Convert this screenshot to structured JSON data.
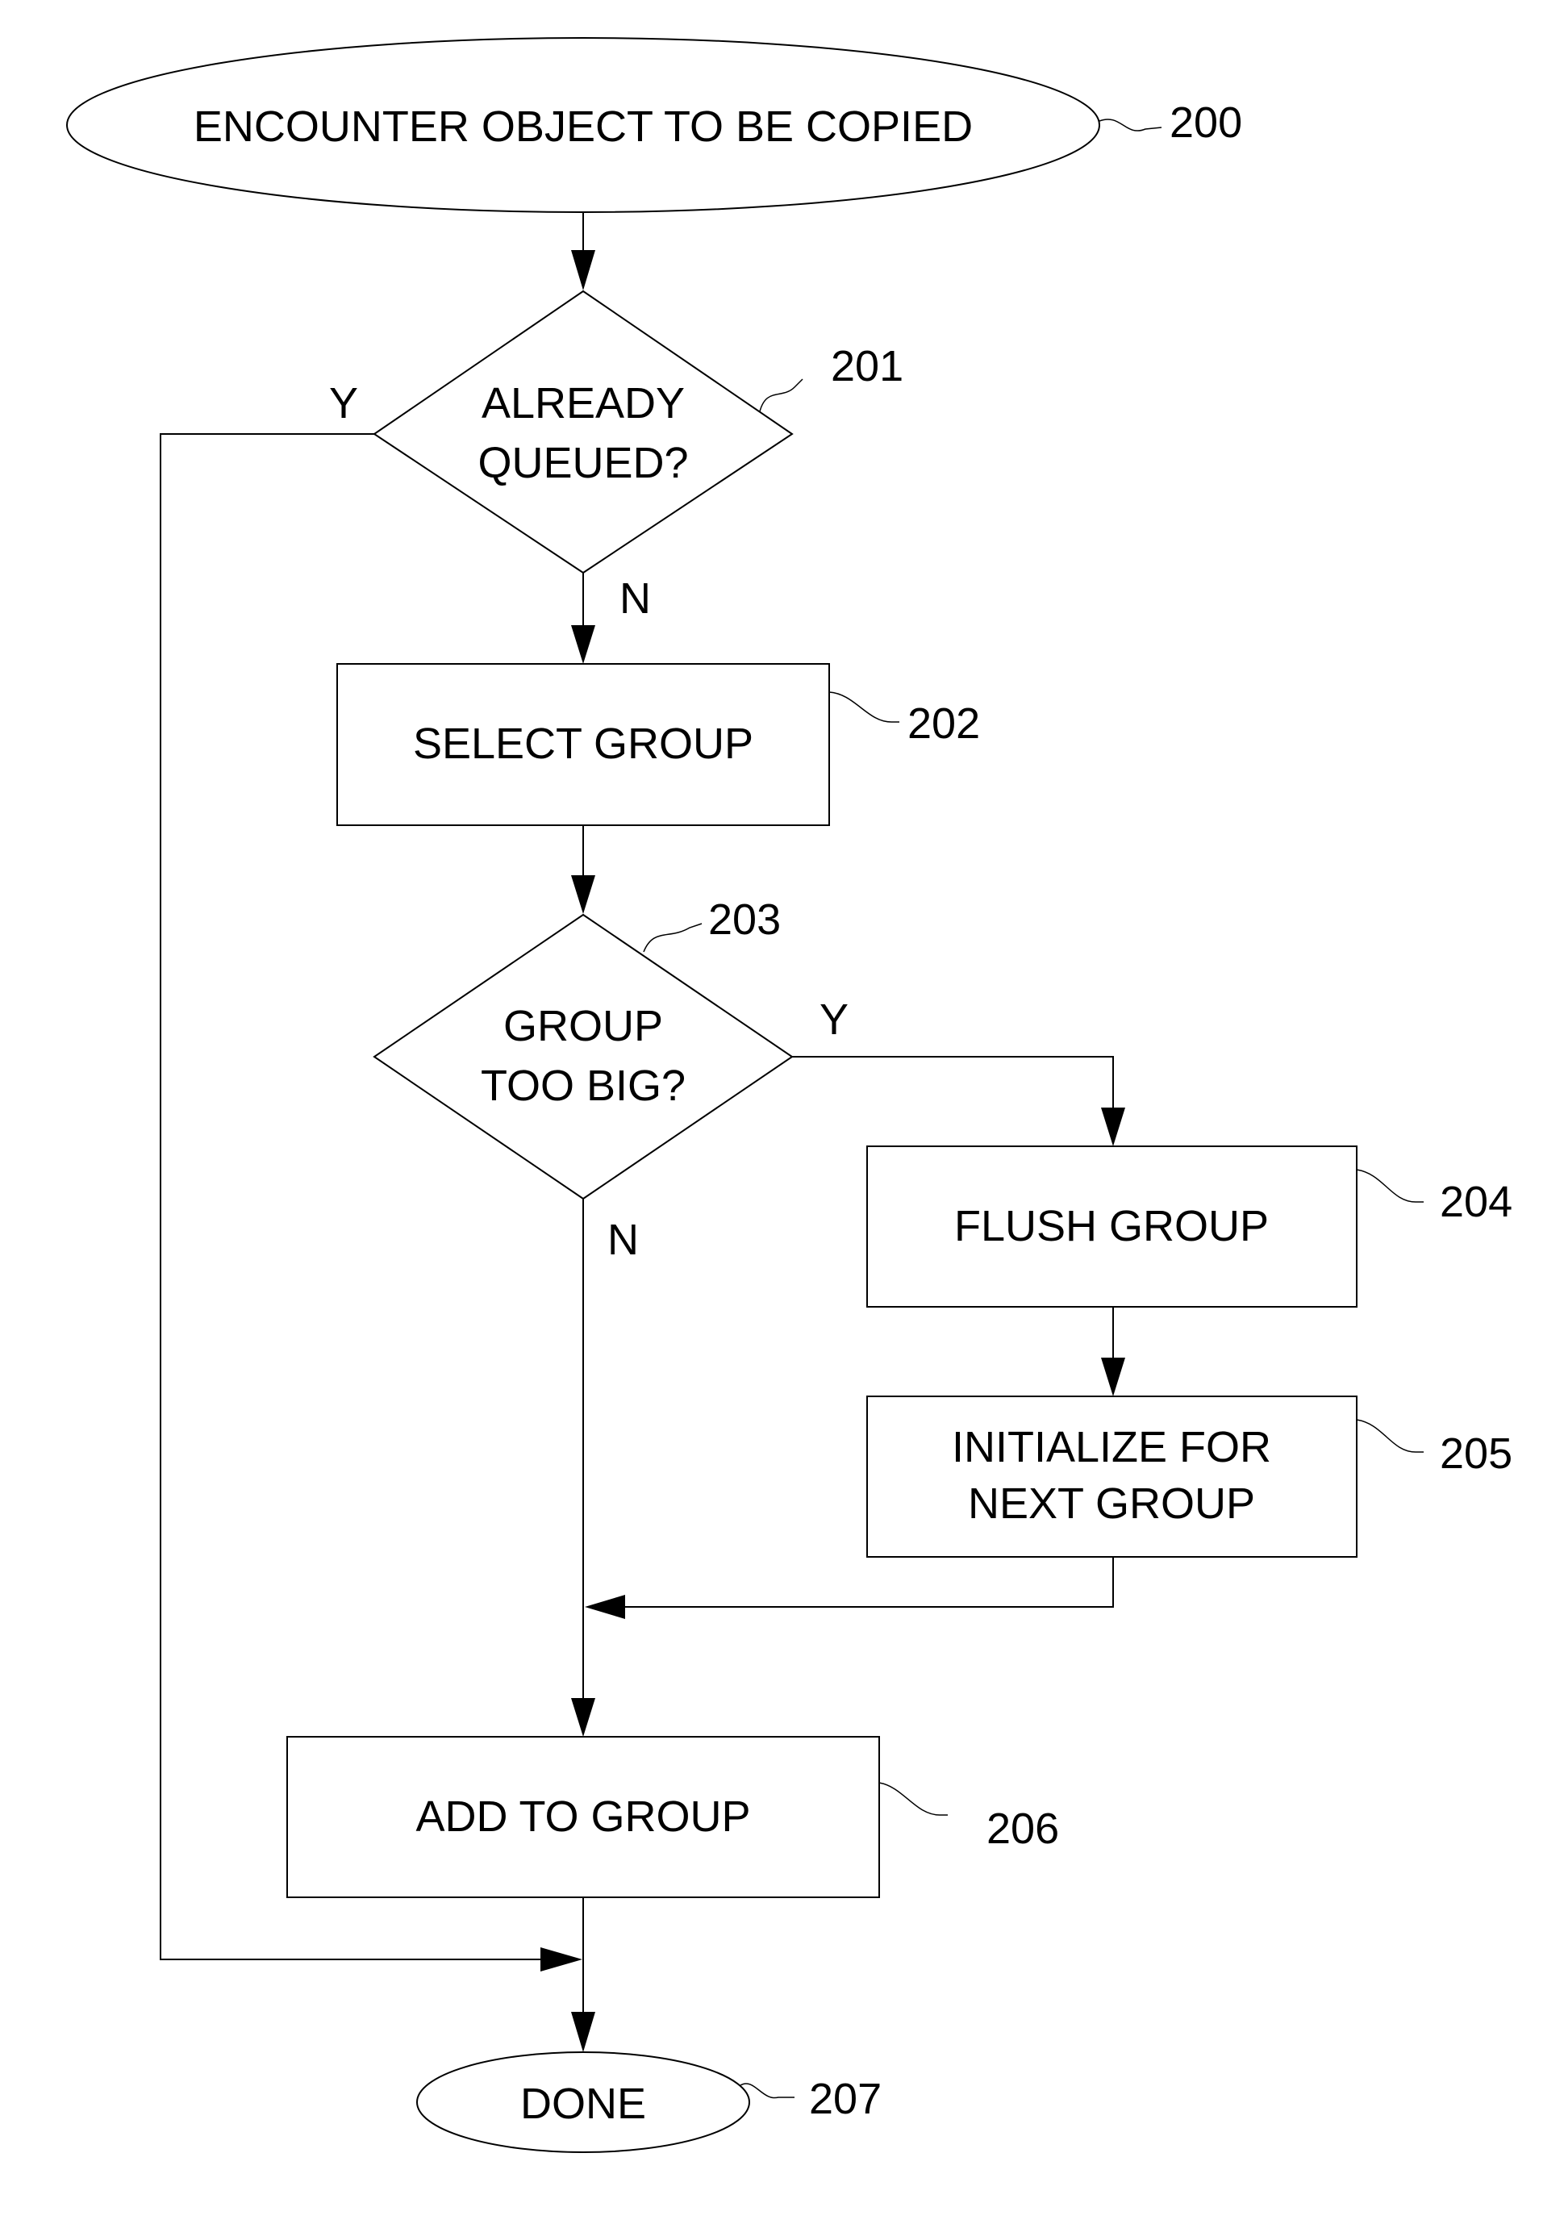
{
  "diagram": {
    "type": "flowchart",
    "nodes": {
      "n200": {
        "ref": "200",
        "shape": "terminal",
        "lines": [
          "ENCOUNTER OBJECT TO BE COPIED"
        ]
      },
      "n201": {
        "ref": "201",
        "shape": "decision",
        "lines": [
          "ALREADY",
          "QUEUED?"
        ]
      },
      "n202": {
        "ref": "202",
        "shape": "process",
        "lines": [
          "SELECT GROUP"
        ]
      },
      "n203": {
        "ref": "203",
        "shape": "decision",
        "lines": [
          "GROUP",
          "TOO BIG?"
        ]
      },
      "n204": {
        "ref": "204",
        "shape": "process",
        "lines": [
          "FLUSH GROUP"
        ]
      },
      "n205": {
        "ref": "205",
        "shape": "process",
        "lines": [
          "INITIALIZE FOR",
          "NEXT GROUP"
        ]
      },
      "n206": {
        "ref": "206",
        "shape": "process",
        "lines": [
          "ADD TO GROUP"
        ]
      },
      "n207": {
        "ref": "207",
        "shape": "terminal",
        "lines": [
          "DONE"
        ]
      }
    },
    "edge_labels": {
      "e201_yes": "Y",
      "e201_no": "N",
      "e203_yes": "Y",
      "e203_no": "N"
    },
    "edges": [
      {
        "from": "200",
        "to": "201"
      },
      {
        "from": "201",
        "to": "202",
        "label": "N"
      },
      {
        "from": "201",
        "to": "207",
        "label": "Y"
      },
      {
        "from": "202",
        "to": "203"
      },
      {
        "from": "203",
        "to": "204",
        "label": "Y"
      },
      {
        "from": "203",
        "to": "206",
        "label": "N"
      },
      {
        "from": "204",
        "to": "205"
      },
      {
        "from": "205",
        "to": "206"
      },
      {
        "from": "206",
        "to": "207"
      }
    ]
  }
}
